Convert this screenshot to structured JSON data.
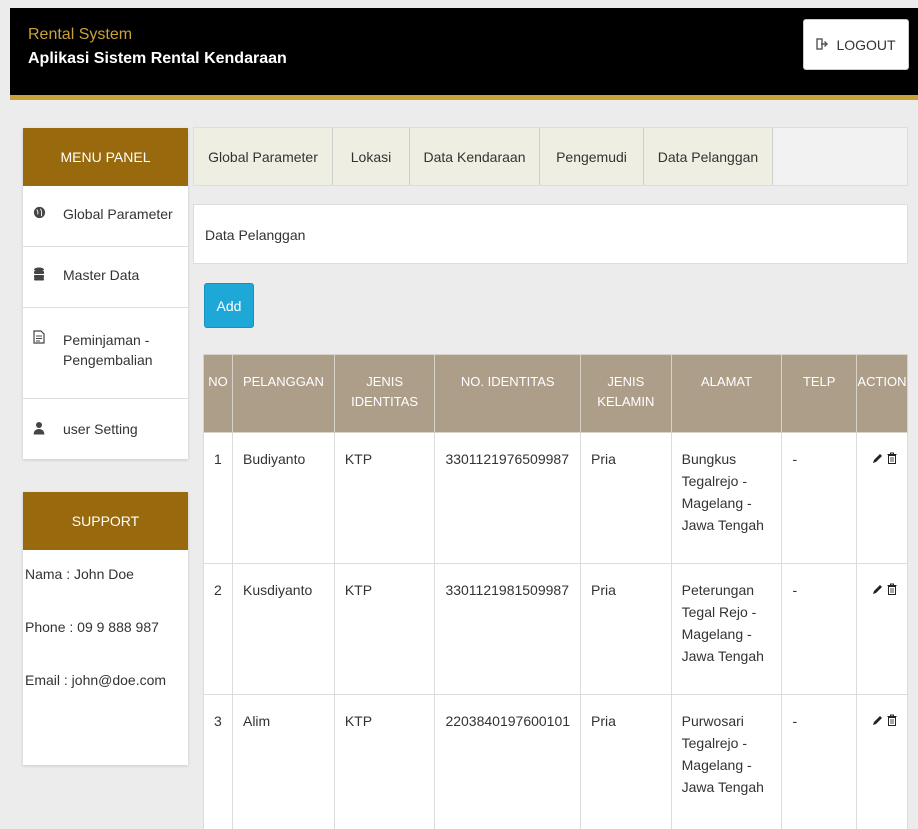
{
  "header": {
    "app_name": "Rental System",
    "app_title": "Aplikasi Sistem Rental Kendaraan",
    "logout_label": "LOGOUT",
    "logout_icon": "logout-icon"
  },
  "colors": {
    "brand_gold": "#c9a13a",
    "panel_header": "#99690e",
    "table_header": "#ad9e8a",
    "add_button": "#1ea8d8"
  },
  "sidebar": {
    "menu_title": "MENU PANEL",
    "items": [
      {
        "label": "Global Parameter",
        "icon": "globe-icon"
      },
      {
        "label": "Master Data",
        "icon": "database-icon"
      },
      {
        "label": "Peminjaman - Pengembalian",
        "icon": "document-icon"
      },
      {
        "label": "user Setting",
        "icon": "user-icon"
      }
    ],
    "support_title": "SUPPORT",
    "support_lines": [
      "Nama : John Doe",
      "Phone : 09 9 888 987",
      "Email : john@doe.com"
    ]
  },
  "tabs": [
    "Global Parameter",
    "Lokasi",
    "Data Kendaraan",
    "Pengemudi",
    "Data Pelanggan"
  ],
  "content": {
    "heading": "Data Pelanggan",
    "add_label": "Add"
  },
  "table": {
    "columns": [
      "NO",
      "PELANGGAN",
      "JENIS IDENTITAS",
      "NO. IDENTITAS",
      "JENIS KELAMIN",
      "ALAMAT",
      "TELP",
      "ACTION"
    ],
    "rows": [
      {
        "no": "1",
        "pelanggan": "Budiyanto",
        "jenis_identitas": "KTP",
        "no_identitas": "3301121976509987",
        "jenis_kelamin": "Pria",
        "alamat": "Bungkus Tegalrejo - Magelang - Jawa Tengah",
        "telp": "-"
      },
      {
        "no": "2",
        "pelanggan": "Kusdiyanto",
        "jenis_identitas": "KTP",
        "no_identitas": "3301121981509987",
        "jenis_kelamin": "Pria",
        "alamat": "Peterungan Tegal Rejo - Magelang - Jawa Tengah",
        "telp": "-"
      },
      {
        "no": "3",
        "pelanggan": "Alim",
        "jenis_identitas": "KTP",
        "no_identitas": "2203840197600101",
        "jenis_kelamin": "Pria",
        "alamat": "Purwosari Tegalrejo - Magelang - Jawa Tengah",
        "telp": "-"
      }
    ],
    "action_icons": [
      "pencil-icon",
      "trash-icon"
    ]
  }
}
